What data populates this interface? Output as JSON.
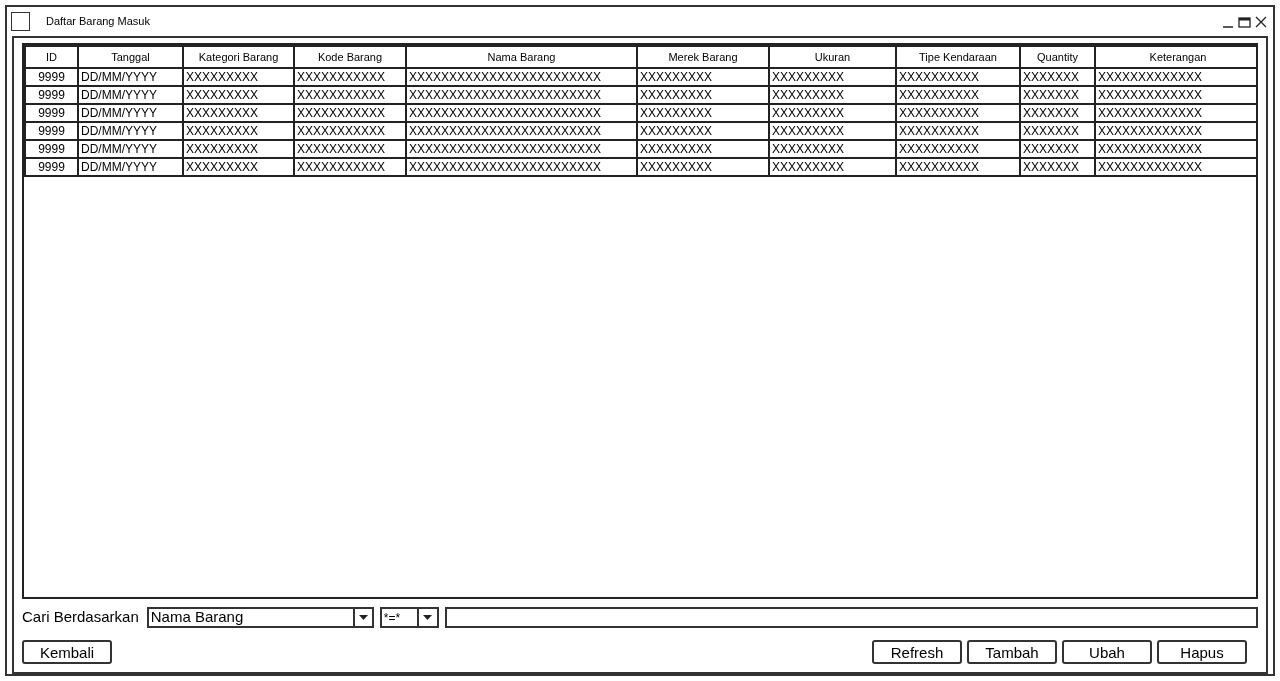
{
  "window": {
    "title": "Daftar Barang Masuk"
  },
  "table": {
    "columns": [
      "ID",
      "Tanggal",
      "Kategori Barang",
      "Kode Barang",
      "Nama Barang",
      "Merek Barang",
      "Ukuran",
      "Tipe Kendaraan",
      "Quantity",
      "Keterangan"
    ],
    "rows": [
      [
        "9999",
        "DD/MM/YYYY",
        "XXXXXXXXX",
        "XXXXXXXXXXX",
        "XXXXXXXXXXXXXXXXXXXXXXXX",
        "XXXXXXXXX",
        "XXXXXXXXX",
        "XXXXXXXXXX",
        "XXXXXXX",
        "XXXXXXXXXXXXX"
      ],
      [
        "9999",
        "DD/MM/YYYY",
        "XXXXXXXXX",
        "XXXXXXXXXXX",
        "XXXXXXXXXXXXXXXXXXXXXXXX",
        "XXXXXXXXX",
        "XXXXXXXXX",
        "XXXXXXXXXX",
        "XXXXXXX",
        "XXXXXXXXXXXXX"
      ],
      [
        "9999",
        "DD/MM/YYYY",
        "XXXXXXXXX",
        "XXXXXXXXXXX",
        "XXXXXXXXXXXXXXXXXXXXXXXX",
        "XXXXXXXXX",
        "XXXXXXXXX",
        "XXXXXXXXXX",
        "XXXXXXX",
        "XXXXXXXXXXXXX"
      ],
      [
        "9999",
        "DD/MM/YYYY",
        "XXXXXXXXX",
        "XXXXXXXXXXX",
        "XXXXXXXXXXXXXXXXXXXXXXXX",
        "XXXXXXXXX",
        "XXXXXXXXX",
        "XXXXXXXXXX",
        "XXXXXXX",
        "XXXXXXXXXXXXX"
      ],
      [
        "9999",
        "DD/MM/YYYY",
        "XXXXXXXXX",
        "XXXXXXXXXXX",
        "XXXXXXXXXXXXXXXXXXXXXXXX",
        "XXXXXXXXX",
        "XXXXXXXXX",
        "XXXXXXXXXX",
        "XXXXXXX",
        "XXXXXXXXXXXXX"
      ],
      [
        "9999",
        "DD/MM/YYYY",
        "XXXXXXXXX",
        "XXXXXXXXXXX",
        "XXXXXXXXXXXXXXXXXXXXXXXX",
        "XXXXXXXXX",
        "XXXXXXXXX",
        "XXXXXXXXXX",
        "XXXXXXX",
        "XXXXXXXXXXXXX"
      ]
    ]
  },
  "search": {
    "label": "Cari Berdasarkan",
    "field": "Nama Barang",
    "operator": "*=*"
  },
  "buttons": {
    "left": [
      "Kembali"
    ],
    "right": [
      "Refresh",
      "Tambah",
      "Ubah",
      "Hapus"
    ]
  }
}
